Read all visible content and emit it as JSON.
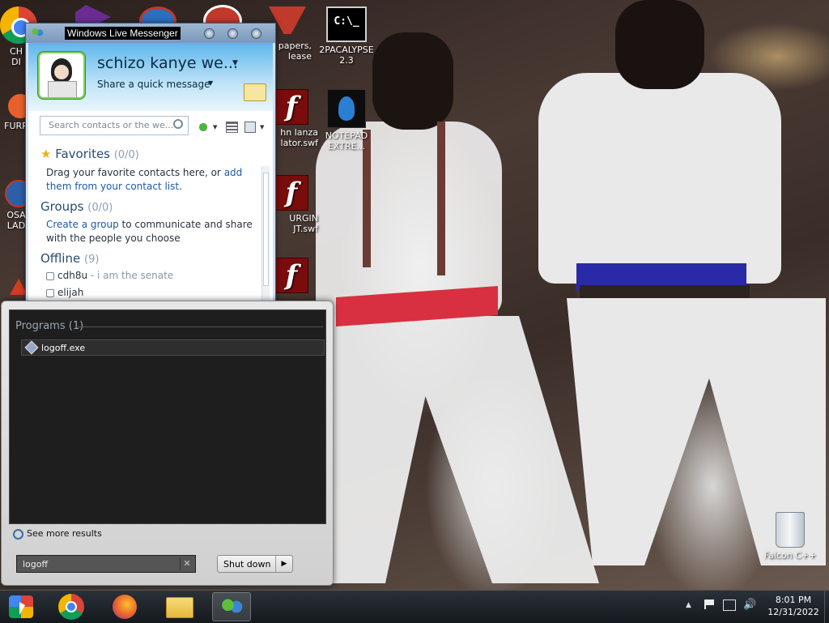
{
  "desktop": {
    "icons": [
      {
        "label": "CH\nDI",
        "kind": "chrome"
      },
      {
        "label": "",
        "kind": "vs"
      },
      {
        "label": "",
        "kind": "app"
      },
      {
        "label": "",
        "kind": "app2"
      },
      {
        "label": "papers,\nlease",
        "kind": "app3"
      },
      {
        "label": "2PACALYPSE\n2.3",
        "kind": "cmd"
      },
      {
        "label": "FURR",
        "kind": "other"
      },
      {
        "label": "hn lanza\nlator.swf",
        "kind": "flash"
      },
      {
        "label": "NOTEPAD\nEXTRE...",
        "kind": "notepad"
      },
      {
        "label": "OSA\nLAD",
        "kind": "other"
      },
      {
        "label": "URGIN\nJT.swf",
        "kind": "flash"
      },
      {
        "label": "Falcon C++",
        "kind": "bin"
      }
    ]
  },
  "messenger": {
    "window_title": "Windows Live Messenger",
    "display_name": "schizo kanye we...",
    "quick_message": "Share a quick message",
    "search_placeholder": "Search contacts or the we...",
    "favorites": {
      "title": "Favorites",
      "count": "(0/0)",
      "text_before": "Drag your favorite contacts here, or ",
      "link": "add them from your contact list",
      "text_after": "."
    },
    "groups": {
      "title": "Groups",
      "count": "(0/0)",
      "link": "Create a group",
      "text_after": " to communicate and share with the people you choose"
    },
    "offline": {
      "title": "Offline",
      "count": "(9)"
    },
    "contacts": [
      {
        "name": "cdh8u",
        "status": " - i am the senate"
      },
      {
        "name": "elijah",
        "status": ""
      }
    ]
  },
  "start_menu": {
    "results_heading": "Programs (1)",
    "results": [
      {
        "label": "logoff.exe"
      }
    ],
    "see_more": "See more results",
    "search_value": "logoff",
    "shutdown_label": "Shut down"
  },
  "taskbar": {
    "pinned": [
      "start-orb",
      "chrome",
      "firefox",
      "explorer",
      "messenger"
    ],
    "clock": {
      "time": "8:01 PM",
      "date": "12/31/2022"
    }
  }
}
